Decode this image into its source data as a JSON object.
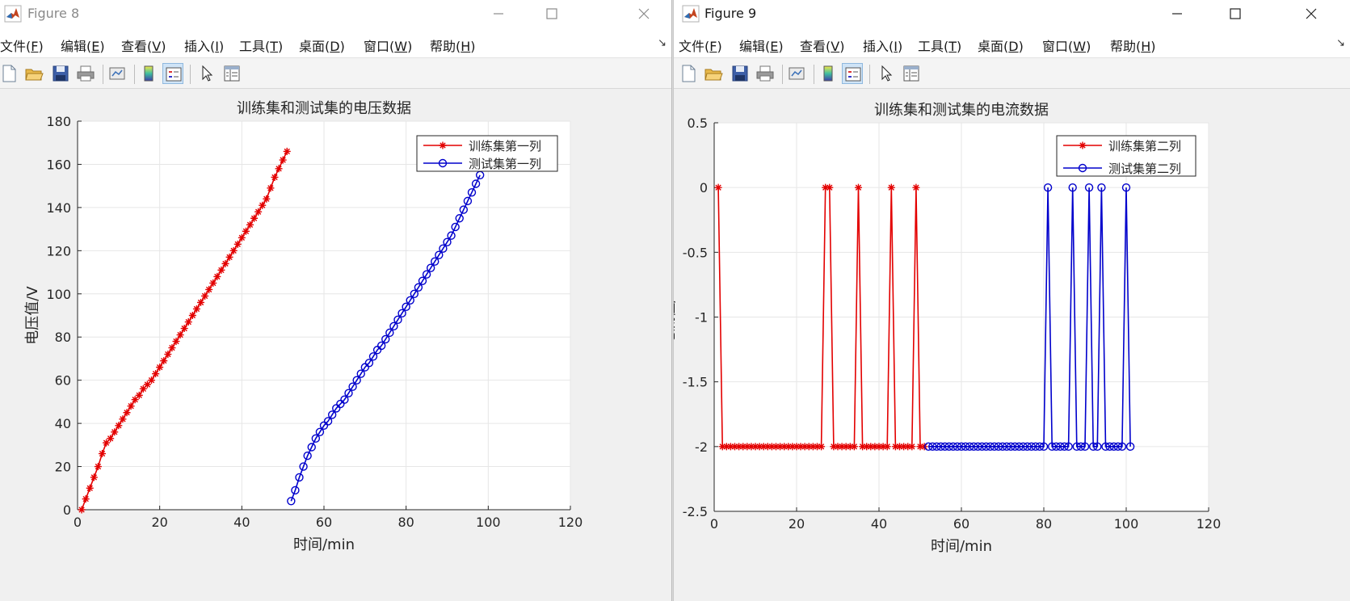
{
  "windows": [
    {
      "title": "Figure 8",
      "menu": [
        {
          "label": "文件(",
          "key": "F",
          "end": ")"
        },
        {
          "label": "编辑(",
          "key": "E",
          "end": ")"
        },
        {
          "label": "查看(",
          "key": "V",
          "end": ")"
        },
        {
          "label": "插入(",
          "key": "I",
          "end": ")"
        },
        {
          "label": "工具(",
          "key": "T",
          "end": ")"
        },
        {
          "label": "桌面(",
          "key": "D",
          "end": ")"
        },
        {
          "label": "窗口(",
          "key": "W",
          "end": ")"
        },
        {
          "label": "帮助(",
          "key": "H",
          "end": ")"
        }
      ],
      "dock_arrow": "↘"
    },
    {
      "title": "Figure 9",
      "menu": [
        {
          "label": "文件(",
          "key": "F",
          "end": ")"
        },
        {
          "label": "编辑(",
          "key": "E",
          "end": ")"
        },
        {
          "label": "查看(",
          "key": "V",
          "end": ")"
        },
        {
          "label": "插入(",
          "key": "I",
          "end": ")"
        },
        {
          "label": "工具(",
          "key": "T",
          "end": ")"
        },
        {
          "label": "桌面(",
          "key": "D",
          "end": ")"
        },
        {
          "label": "窗口(",
          "key": "W",
          "end": ")"
        },
        {
          "label": "帮助(",
          "key": "H",
          "end": ")"
        }
      ],
      "dock_arrow": "↘"
    }
  ],
  "toolbar_icons": [
    "new-figure-icon",
    "open-file-icon",
    "save-icon",
    "print-icon",
    "link-plot-icon",
    "insert-colorbar-icon",
    "insert-legend-icon",
    "edit-plot-pointer-icon",
    "property-inspector-icon"
  ],
  "colors": {
    "train": "#e30000",
    "test": "#0000cc"
  },
  "chart_data": [
    {
      "type": "line",
      "title": "训练集和测试集的电压数据",
      "xlabel": "时间/min",
      "ylabel": "电压值/V",
      "xlim": [
        0,
        120
      ],
      "ylim": [
        0,
        180
      ],
      "xticks": [
        "0",
        "20",
        "40",
        "60",
        "80",
        "100",
        "120"
      ],
      "yticks": [
        "0",
        "20",
        "40",
        "60",
        "80",
        "100",
        "120",
        "140",
        "160",
        "180"
      ],
      "grid": true,
      "legend_position": "top-right",
      "series": [
        {
          "name": "训练集第一列",
          "marker": "star",
          "color": "#e30000",
          "x": [
            1,
            2,
            3,
            4,
            5,
            6,
            7,
            8,
            9,
            10,
            11,
            12,
            13,
            14,
            15,
            16,
            17,
            18,
            19,
            20,
            21,
            22,
            23,
            24,
            25,
            26,
            27,
            28,
            29,
            30,
            31,
            32,
            33,
            34,
            35,
            36,
            37,
            38,
            39,
            40,
            41,
            42,
            43,
            44,
            45,
            46,
            47,
            48,
            49,
            50,
            51
          ],
          "y": [
            0,
            5,
            10,
            15,
            20,
            26,
            31,
            33,
            36,
            39,
            42,
            45,
            48,
            51,
            53,
            56,
            58,
            60,
            63,
            66,
            69,
            72,
            75,
            78,
            81,
            84,
            87,
            90,
            93,
            96,
            99,
            102,
            105,
            108,
            111,
            114,
            117,
            120,
            123,
            126,
            129,
            132,
            135,
            138,
            141,
            144,
            149,
            154,
            158,
            162,
            166
          ]
        },
        {
          "name": "测试集第一列",
          "marker": "circle",
          "color": "#0000cc",
          "x": [
            52,
            53,
            54,
            55,
            56,
            57,
            58,
            59,
            60,
            61,
            62,
            63,
            64,
            65,
            66,
            67,
            68,
            69,
            70,
            71,
            72,
            73,
            74,
            75,
            76,
            77,
            78,
            79,
            80,
            81,
            82,
            83,
            84,
            85,
            86,
            87,
            88,
            89,
            90,
            91,
            92,
            93,
            94,
            95,
            96,
            97,
            98
          ],
          "y": [
            4,
            9,
            15,
            20,
            25,
            29,
            33,
            36,
            39,
            41,
            44,
            47,
            49,
            51,
            54,
            57,
            60,
            63,
            66,
            68,
            71,
            74,
            76,
            79,
            82,
            85,
            88,
            91,
            94,
            97,
            100,
            103,
            106,
            109,
            112,
            115,
            118,
            121,
            124,
            127,
            131,
            135,
            139,
            143,
            147,
            151,
            155
          ]
        }
      ]
    },
    {
      "type": "line",
      "title": "训练集和测试集的电流数据",
      "xlabel": "时间/min",
      "ylabel": "电流值/A",
      "xlim": [
        0,
        120
      ],
      "ylim": [
        -2.5,
        0.5
      ],
      "xticks": [
        "0",
        "20",
        "40",
        "60",
        "80",
        "100",
        "120"
      ],
      "yticks": [
        "-2.5",
        "-2",
        "-1.5",
        "-1",
        "-0.5",
        "0",
        "0.5"
      ],
      "grid": true,
      "legend_position": "top-right",
      "series": [
        {
          "name": "训练集第二列",
          "marker": "star",
          "color": "#e30000",
          "x": [
            1,
            2,
            3,
            4,
            5,
            6,
            7,
            8,
            9,
            10,
            11,
            12,
            13,
            14,
            15,
            16,
            17,
            18,
            19,
            20,
            21,
            22,
            23,
            24,
            25,
            26,
            27,
            28,
            29,
            30,
            31,
            32,
            33,
            34,
            35,
            36,
            37,
            38,
            39,
            40,
            41,
            42,
            43,
            44,
            45,
            46,
            47,
            48,
            49,
            50,
            51
          ],
          "y": [
            0,
            -2,
            -2,
            -2,
            -2,
            -2,
            -2,
            -2,
            -2,
            -2,
            -2,
            -2,
            -2,
            -2,
            -2,
            -2,
            -2,
            -2,
            -2,
            -2,
            -2,
            -2,
            -2,
            -2,
            -2,
            -2,
            0,
            0,
            -2,
            -2,
            -2,
            -2,
            -2,
            -2,
            0,
            -2,
            -2,
            -2,
            -2,
            -2,
            -2,
            -2,
            0,
            -2,
            -2,
            -2,
            -2,
            -2,
            0,
            -2,
            -2
          ]
        },
        {
          "name": "测试集第二列",
          "marker": "circle",
          "color": "#0000cc",
          "x": [
            52,
            53,
            54,
            55,
            56,
            57,
            58,
            59,
            60,
            61,
            62,
            63,
            64,
            65,
            66,
            67,
            68,
            69,
            70,
            71,
            72,
            73,
            74,
            75,
            76,
            77,
            78,
            79,
            80,
            81,
            82,
            83,
            84,
            85,
            86,
            87,
            88,
            89,
            90,
            91,
            92,
            93,
            94,
            95,
            96,
            97,
            98,
            99,
            100,
            101
          ],
          "y": [
            -2,
            -2,
            -2,
            -2,
            -2,
            -2,
            -2,
            -2,
            -2,
            -2,
            -2,
            -2,
            -2,
            -2,
            -2,
            -2,
            -2,
            -2,
            -2,
            -2,
            -2,
            -2,
            -2,
            -2,
            -2,
            -2,
            -2,
            -2,
            -2,
            0,
            -2,
            -2,
            -2,
            -2,
            -2,
            0,
            -2,
            -2,
            -2,
            0,
            -2,
            -2,
            0,
            -2,
            -2,
            -2,
            -2,
            -2,
            0,
            -2
          ]
        }
      ]
    }
  ]
}
